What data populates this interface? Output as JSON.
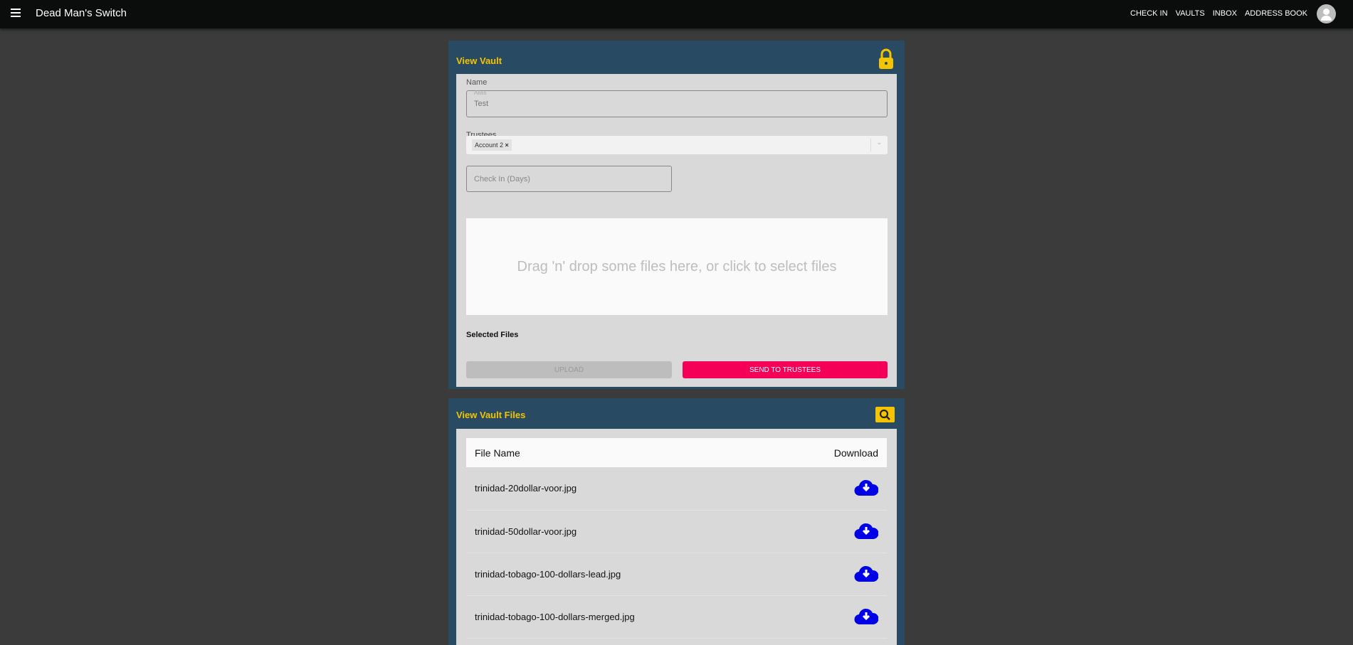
{
  "nav": {
    "title": "Dead Man's Switch",
    "links": [
      "CHECK IN",
      "VAULTS",
      "INBOX",
      "ADDRESS BOOK"
    ]
  },
  "vault": {
    "title": "View Vault",
    "name_label": "Name",
    "name_placeholder": "Alias",
    "name_value": "Test",
    "trustees_label": "Trustees",
    "trustees": [
      "Account 2"
    ],
    "checkin_placeholder": "Check In (Days)",
    "dropzone": "Drag 'n' drop some files here, or click to select files",
    "selected_files_label": "Selected Files",
    "upload_label": "UPLOAD",
    "send_label": "SEND TO TRUSTEES"
  },
  "files": {
    "title": "View Vault Files",
    "columns": [
      "File Name",
      "Download"
    ],
    "rows": [
      "trinidad-20dollar-voor.jpg",
      "trinidad-50dollar-voor.jpg",
      "trinidad-tobago-100-dollars-lead.jpg",
      "trinidad-tobago-100-dollars-merged.jpg"
    ]
  },
  "colors": {
    "accent": "#f5c400",
    "send": "#f50057",
    "download": "#0000e6",
    "panel": "#284b63"
  }
}
